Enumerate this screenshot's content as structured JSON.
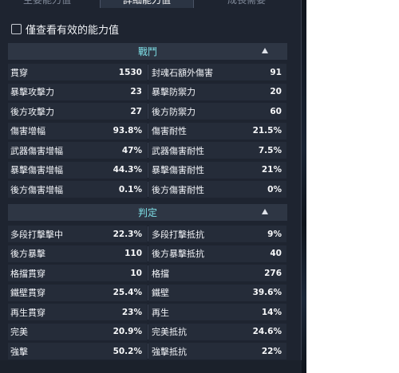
{
  "tabs": [
    {
      "label": "主要能力值"
    },
    {
      "label": "詳細能力值"
    },
    {
      "label": "成長需要"
    }
  ],
  "filter": {
    "label": "僅查看有效的能力值"
  },
  "sections": [
    {
      "title": "戰鬥",
      "rows": [
        [
          {
            "label": "貫穿",
            "value": "1530"
          },
          {
            "label": "封魂石額外傷害",
            "value": "91"
          }
        ],
        [
          {
            "label": "暴擊攻擊力",
            "value": "23"
          },
          {
            "label": "暴擊防禦力",
            "value": "20"
          }
        ],
        [
          {
            "label": "後方攻擊力",
            "value": "27"
          },
          {
            "label": "後方防禦力",
            "value": "60"
          }
        ],
        [
          {
            "label": "傷害增幅",
            "value": "93.8%"
          },
          {
            "label": "傷害耐性",
            "value": "21.5%"
          }
        ],
        [
          {
            "label": "武器傷害增幅",
            "value": "47%"
          },
          {
            "label": "武器傷害耐性",
            "value": "7.5%"
          }
        ],
        [
          {
            "label": "暴擊傷害增幅",
            "value": "44.3%"
          },
          {
            "label": "暴擊傷害耐性",
            "value": "21%"
          }
        ],
        [
          {
            "label": "後方傷害增幅",
            "value": "0.1%"
          },
          {
            "label": "後方傷害耐性",
            "value": "0%"
          }
        ]
      ]
    },
    {
      "title": "判定",
      "rows": [
        [
          {
            "label": "多段打擊擊中",
            "value": "22.3%"
          },
          {
            "label": "多段打擊抵抗",
            "value": "9%"
          }
        ],
        [
          {
            "label": "後方暴擊",
            "value": "110"
          },
          {
            "label": "後方暴擊抵抗",
            "value": "40"
          }
        ],
        [
          {
            "label": "格擋貫穿",
            "value": "10"
          },
          {
            "label": "格擋",
            "value": "276"
          }
        ],
        [
          {
            "label": "鐵壁貫穿",
            "value": "25.4%"
          },
          {
            "label": "鐵壁",
            "value": "39.6%"
          }
        ],
        [
          {
            "label": "再生貫穿",
            "value": "23%"
          },
          {
            "label": "再生",
            "value": "14%"
          }
        ],
        [
          {
            "label": "完美",
            "value": "20.9%"
          },
          {
            "label": "完美抵抗",
            "value": "24.6%"
          }
        ],
        [
          {
            "label": "強擊",
            "value": "50.2%"
          },
          {
            "label": "強擊抵抗",
            "value": "22%"
          }
        ]
      ]
    }
  ],
  "colors": {
    "panel_bg": "#1e2430",
    "cell_bg": "#252c39",
    "header_bg": "#2e3644",
    "header_text": "#7fe1e8"
  },
  "icons": {
    "collapse": "chevron-up-icon",
    "checkbox": "checkbox-icon"
  }
}
